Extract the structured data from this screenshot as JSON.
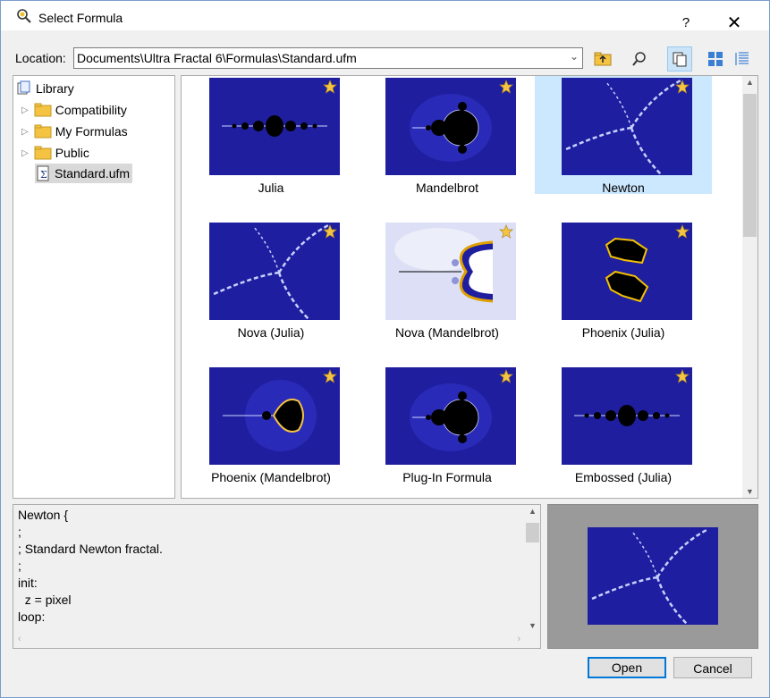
{
  "window": {
    "title": "Select Formula",
    "help_label": "?",
    "close_label": "✕"
  },
  "location": {
    "label": "Location:",
    "value": "Documents\\Ultra Fractal 6\\Formulas\\Standard.ufm"
  },
  "toolbar": {
    "icons": [
      "folder-up-icon",
      "search-formula-icon",
      "copy-icon",
      "large-icons-view-icon",
      "details-view-icon"
    ]
  },
  "tree": {
    "root": "Library",
    "items": [
      {
        "label": "Compatibility"
      },
      {
        "label": "My Formulas"
      },
      {
        "label": "Public"
      },
      {
        "label": "Standard.ufm"
      }
    ]
  },
  "gallery": {
    "items": [
      {
        "label": "Julia",
        "fractal": "julia"
      },
      {
        "label": "Mandelbrot",
        "fractal": "mandel"
      },
      {
        "label": "Newton",
        "fractal": "newton",
        "selected": true
      },
      {
        "label": "Nova (Julia)",
        "fractal": "newton"
      },
      {
        "label": "Nova (Mandelbrot)",
        "fractal": "nova"
      },
      {
        "label": "Phoenix (Julia)",
        "fractal": "phoenix"
      },
      {
        "label": "Phoenix (Mandelbrot)",
        "fractal": "phoenixm"
      },
      {
        "label": "Plug-In Formula",
        "fractal": "mandel"
      },
      {
        "label": "Embossed (Julia)",
        "fractal": "julia"
      }
    ]
  },
  "code": {
    "lines": [
      "Newton {",
      ";",
      "; Standard Newton fractal.",
      ";",
      "init:",
      "  z = pixel",
      "loop:"
    ]
  },
  "buttons": {
    "open": "Open",
    "cancel": "Cancel"
  },
  "colors": {
    "accent": "#0078d7",
    "fractal_bg": "#1e1e9e",
    "selection": "#cce8ff"
  }
}
